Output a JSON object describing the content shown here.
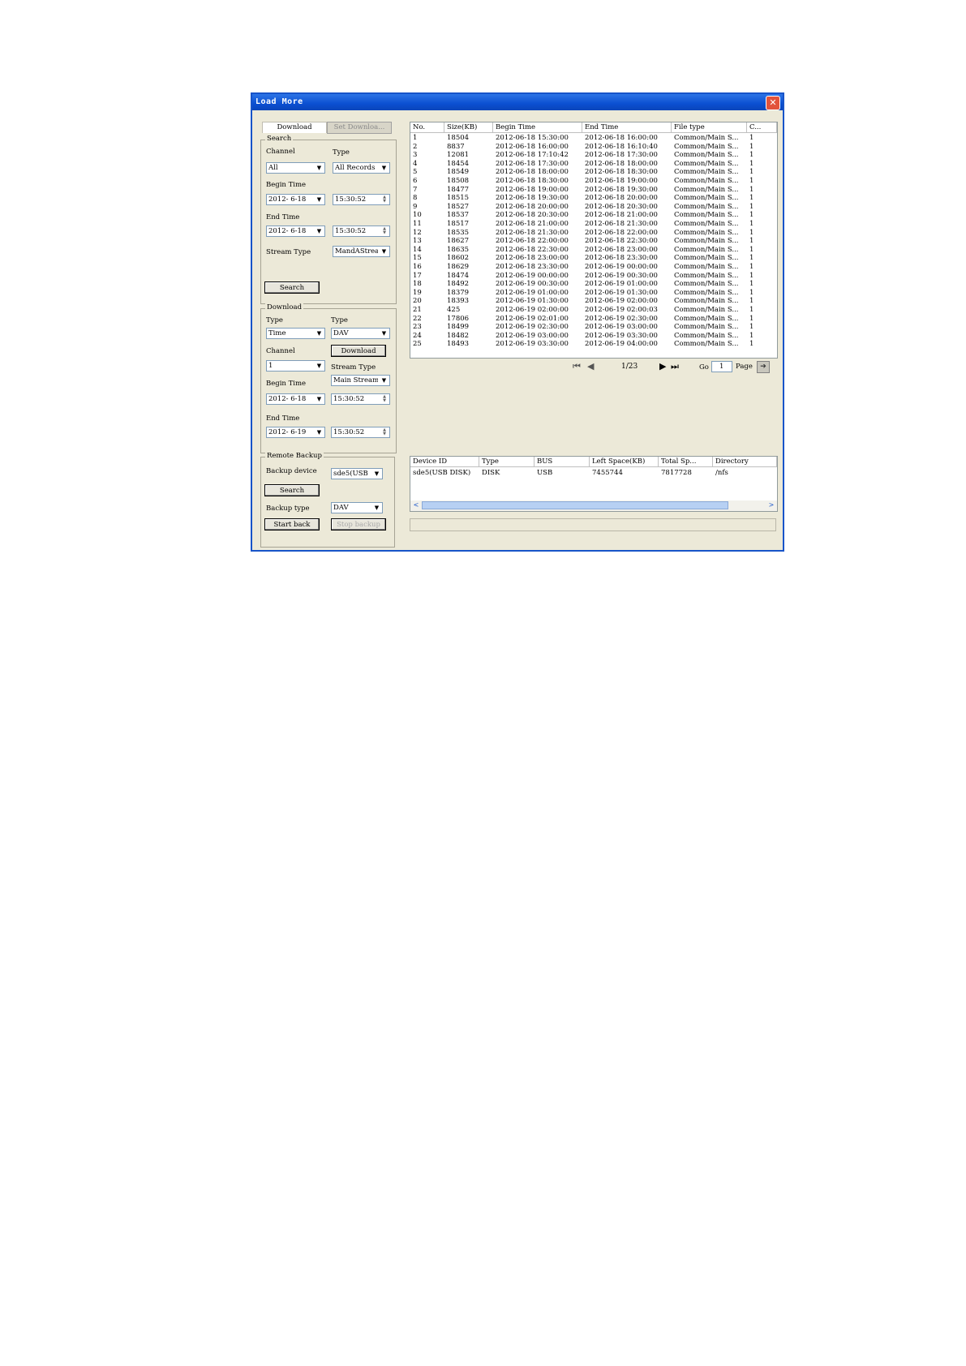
{
  "window": {
    "title": "Load More",
    "close_label": "✕"
  },
  "tabs": [
    {
      "label": "Download"
    },
    {
      "label": "Set Downloa..."
    }
  ],
  "search": {
    "legend": "Search",
    "channel_label": "Channel",
    "channel_value": "All",
    "type_label": "Type",
    "type_value": "All Records",
    "begin_label": "Begin Time",
    "begin_date": "2012- 6-18",
    "begin_time": "15:30:52",
    "end_label": "End Time",
    "end_date": "2012- 6-18",
    "end_time": "15:30:52",
    "stream_label": "Stream Type",
    "stream_value": "MandAStream",
    "search_button": "Search"
  },
  "download": {
    "legend": "Download",
    "type_label": "Type",
    "type_value": "Time",
    "type2_label": "Type",
    "type2_value": "DAV",
    "channel_label": "Channel",
    "channel_value": "1",
    "download_button": "Download",
    "stream_label": "Stream Type",
    "stream_value": "Main Stream",
    "begin_label": "Begin Time",
    "begin_date": "2012- 6-18",
    "begin_time": "15:30:52",
    "end_label": "End Time",
    "end_date": "2012- 6-19",
    "end_time": "15:30:52"
  },
  "backup": {
    "legend": "Remote Backup",
    "device_label": "Backup device",
    "device_value": "sde5(USB",
    "search_button": "Search",
    "type_label": "Backup type",
    "type_value": "DAV",
    "start_button": "Start back",
    "stop_button": "Stop backup"
  },
  "records": {
    "columns": [
      "No.",
      "Size(KB)",
      "Begin Time",
      "End Time",
      "File type",
      "C..."
    ],
    "rows": [
      [
        "1",
        "18504",
        "2012-06-18 15:30:00",
        "2012-06-18 16:00:00",
        "Common/Main S...",
        "1"
      ],
      [
        "2",
        "8837",
        "2012-06-18 16:00:00",
        "2012-06-18 16:10:40",
        "Common/Main S...",
        "1"
      ],
      [
        "3",
        "12081",
        "2012-06-18 17:10:42",
        "2012-06-18 17:30:00",
        "Common/Main S...",
        "1"
      ],
      [
        "4",
        "18454",
        "2012-06-18 17:30:00",
        "2012-06-18 18:00:00",
        "Common/Main S...",
        "1"
      ],
      [
        "5",
        "18549",
        "2012-06-18 18:00:00",
        "2012-06-18 18:30:00",
        "Common/Main S...",
        "1"
      ],
      [
        "6",
        "18508",
        "2012-06-18 18:30:00",
        "2012-06-18 19:00:00",
        "Common/Main S...",
        "1"
      ],
      [
        "7",
        "18477",
        "2012-06-18 19:00:00",
        "2012-06-18 19:30:00",
        "Common/Main S...",
        "1"
      ],
      [
        "8",
        "18515",
        "2012-06-18 19:30:00",
        "2012-06-18 20:00:00",
        "Common/Main S...",
        "1"
      ],
      [
        "9",
        "18527",
        "2012-06-18 20:00:00",
        "2012-06-18 20:30:00",
        "Common/Main S...",
        "1"
      ],
      [
        "10",
        "18537",
        "2012-06-18 20:30:00",
        "2012-06-18 21:00:00",
        "Common/Main S...",
        "1"
      ],
      [
        "11",
        "18517",
        "2012-06-18 21:00:00",
        "2012-06-18 21:30:00",
        "Common/Main S...",
        "1"
      ],
      [
        "12",
        "18535",
        "2012-06-18 21:30:00",
        "2012-06-18 22:00:00",
        "Common/Main S...",
        "1"
      ],
      [
        "13",
        "18627",
        "2012-06-18 22:00:00",
        "2012-06-18 22:30:00",
        "Common/Main S...",
        "1"
      ],
      [
        "14",
        "18635",
        "2012-06-18 22:30:00",
        "2012-06-18 23:00:00",
        "Common/Main S...",
        "1"
      ],
      [
        "15",
        "18602",
        "2012-06-18 23:00:00",
        "2012-06-18 23:30:00",
        "Common/Main S...",
        "1"
      ],
      [
        "16",
        "18629",
        "2012-06-18 23:30:00",
        "2012-06-19 00:00:00",
        "Common/Main S...",
        "1"
      ],
      [
        "17",
        "18474",
        "2012-06-19 00:00:00",
        "2012-06-19 00:30:00",
        "Common/Main S...",
        "1"
      ],
      [
        "18",
        "18492",
        "2012-06-19 00:30:00",
        "2012-06-19 01:00:00",
        "Common/Main S...",
        "1"
      ],
      [
        "19",
        "18379",
        "2012-06-19 01:00:00",
        "2012-06-19 01:30:00",
        "Common/Main S...",
        "1"
      ],
      [
        "20",
        "18393",
        "2012-06-19 01:30:00",
        "2012-06-19 02:00:00",
        "Common/Main S...",
        "1"
      ],
      [
        "21",
        "425",
        "2012-06-19 02:00:00",
        "2012-06-19 02:00:03",
        "Common/Main S...",
        "1"
      ],
      [
        "22",
        "17806",
        "2012-06-19 02:01:00",
        "2012-06-19 02:30:00",
        "Common/Main S...",
        "1"
      ],
      [
        "23",
        "18499",
        "2012-06-19 02:30:00",
        "2012-06-19 03:00:00",
        "Common/Main S...",
        "1"
      ],
      [
        "24",
        "18482",
        "2012-06-19 03:00:00",
        "2012-06-19 03:30:00",
        "Common/Main S...",
        "1"
      ],
      [
        "25",
        "18493",
        "2012-06-19 03:30:00",
        "2012-06-19 04:00:00",
        "Common/Main S...",
        "1"
      ]
    ]
  },
  "pager": {
    "first_icon": "skip-first-icon",
    "prev_icon": "prev-icon",
    "next_icon": "next-icon",
    "last_icon": "skip-last-icon",
    "page_info": "1/23",
    "go_label": "Go",
    "go_value": "1",
    "page_label": "Page"
  },
  "devices": {
    "columns": [
      "Device ID",
      "Type",
      "BUS",
      "Left Space(KB)",
      "Total Sp...",
      "Directory"
    ],
    "rows": [
      [
        "sde5(USB DISK)",
        "DISK",
        "USB",
        "7455744",
        "7817728",
        "/nfs"
      ]
    ]
  },
  "colors": {
    "titlebar": "#0b4fd1",
    "dialog_bg": "#ece9d8",
    "close_button": "#e2533b",
    "scroll_thumb": "#b7d0f3"
  }
}
